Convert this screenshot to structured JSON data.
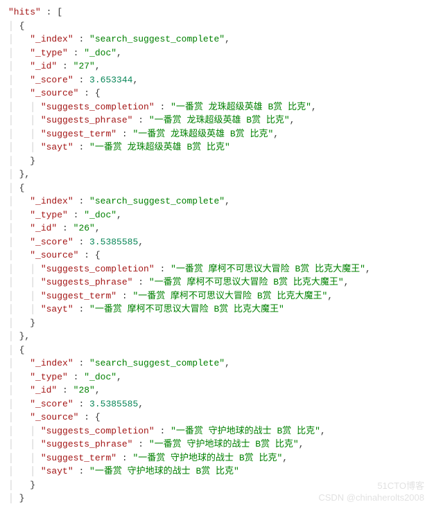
{
  "root_key": "hits",
  "watermark_line1": "51CTO博客",
  "watermark_line2": "CSDN @chinaherolts2008",
  "hits": [
    {
      "_index": "search_suggest_complete",
      "_type": "_doc",
      "_id": "27",
      "_score": 3.653344,
      "_source": {
        "suggests_completion": "一番赏 龙珠超级英雄 B赏 比克",
        "suggests_phrase": "一番赏 龙珠超级英雄 B赏 比克",
        "suggest_term": "一番赏 龙珠超级英雄 B赏 比克",
        "sayt": "一番赏 龙珠超级英雄 B赏 比克"
      }
    },
    {
      "_index": "search_suggest_complete",
      "_type": "_doc",
      "_id": "26",
      "_score": 3.5385585,
      "_source": {
        "suggests_completion": "一番赏 摩柯不可思议大冒险 B赏 比克大魔王",
        "suggests_phrase": "一番赏 摩柯不可思议大冒险 B赏 比克大魔王",
        "suggest_term": "一番赏 摩柯不可思议大冒险 B赏 比克大魔王",
        "sayt": "一番赏 摩柯不可思议大冒险 B赏 比克大魔王"
      }
    },
    {
      "_index": "search_suggest_complete",
      "_type": "_doc",
      "_id": "28",
      "_score": 3.5385585,
      "_source": {
        "suggests_completion": "一番赏 守护地球的战士 B赏 比克",
        "suggests_phrase": "一番赏 守护地球的战士 B赏 比克",
        "suggest_term": "一番赏 守护地球的战士 B赏 比克",
        "sayt": "一番赏 守护地球的战士 B赏 比克"
      }
    }
  ]
}
